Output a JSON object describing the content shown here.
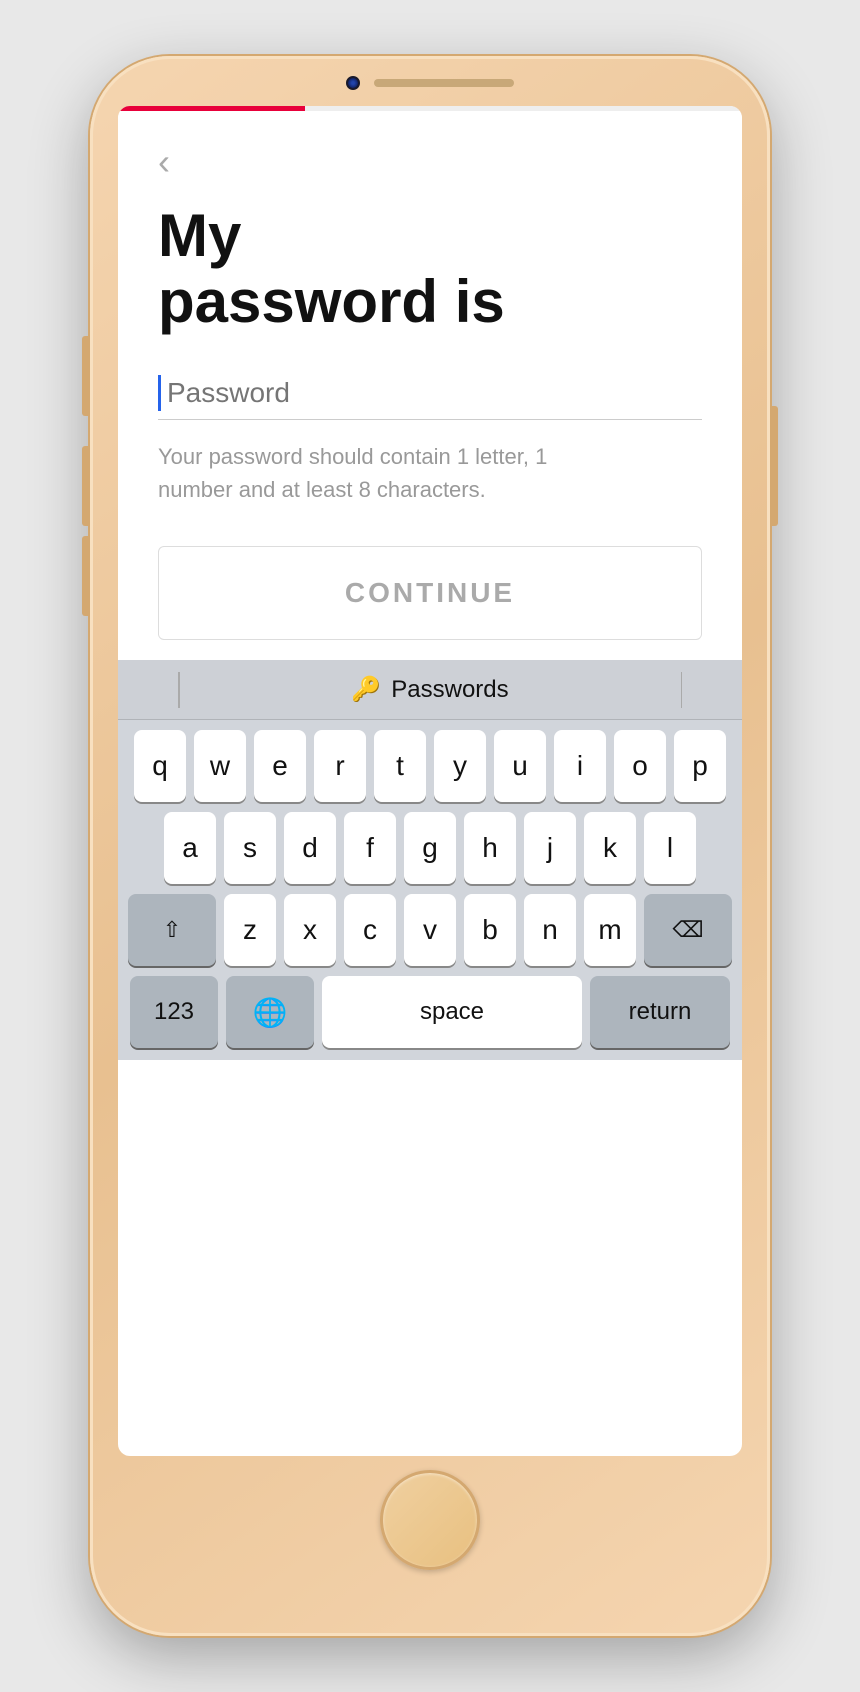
{
  "phone": {
    "progress_width": "30%"
  },
  "app": {
    "back_button": "‹",
    "title_line1": "My",
    "title_line2": "password is",
    "password_placeholder": "Password",
    "hint_text": "Your password should contain 1 letter, 1 number and at least 8 characters.",
    "continue_label": "CONTINUE"
  },
  "keyboard": {
    "toolbar_label": "Passwords",
    "key_icon": "🔑",
    "rows": [
      [
        "q",
        "w",
        "e",
        "r",
        "t",
        "y",
        "u",
        "i",
        "o",
        "p"
      ],
      [
        "a",
        "s",
        "d",
        "f",
        "g",
        "h",
        "j",
        "k",
        "l"
      ],
      [
        "z",
        "x",
        "c",
        "v",
        "b",
        "n",
        "m"
      ]
    ],
    "num_label": "123",
    "globe_label": "🌐",
    "space_label": "space",
    "return_label": "return"
  },
  "colors": {
    "progress_bar": "#e8003a",
    "cursor": "#2563eb",
    "continue_text": "#aaaaaa",
    "hint_text": "#999999",
    "title": "#111111"
  }
}
